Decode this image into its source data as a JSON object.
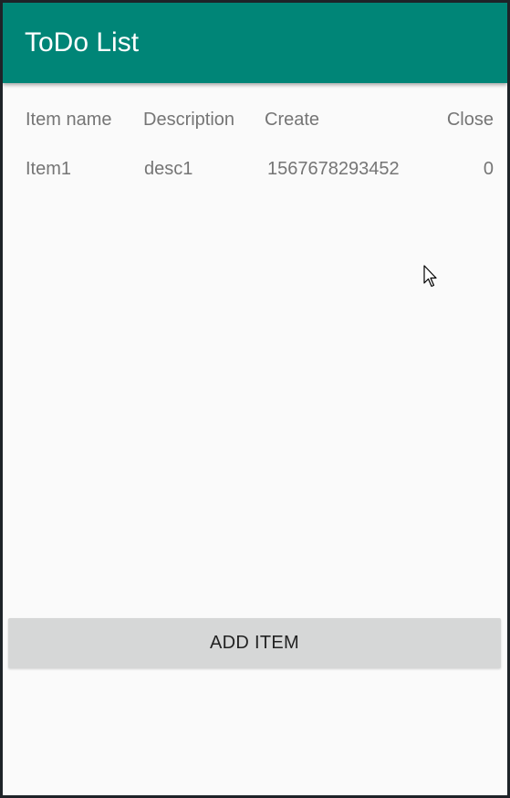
{
  "app": {
    "title": "ToDo List"
  },
  "table": {
    "headers": [
      "Item name",
      "Description",
      "Create",
      "Close"
    ],
    "rows": [
      [
        "Item1",
        "desc1",
        "1567678293452",
        "0"
      ]
    ]
  },
  "actions": {
    "add_item_label": "ADD ITEM"
  },
  "colors": {
    "appbar": "#008577",
    "background": "#fafafa",
    "button": "#d6d7d7",
    "text_secondary": "#757575"
  },
  "icons": {
    "cursor": "mouse-pointer-icon"
  }
}
